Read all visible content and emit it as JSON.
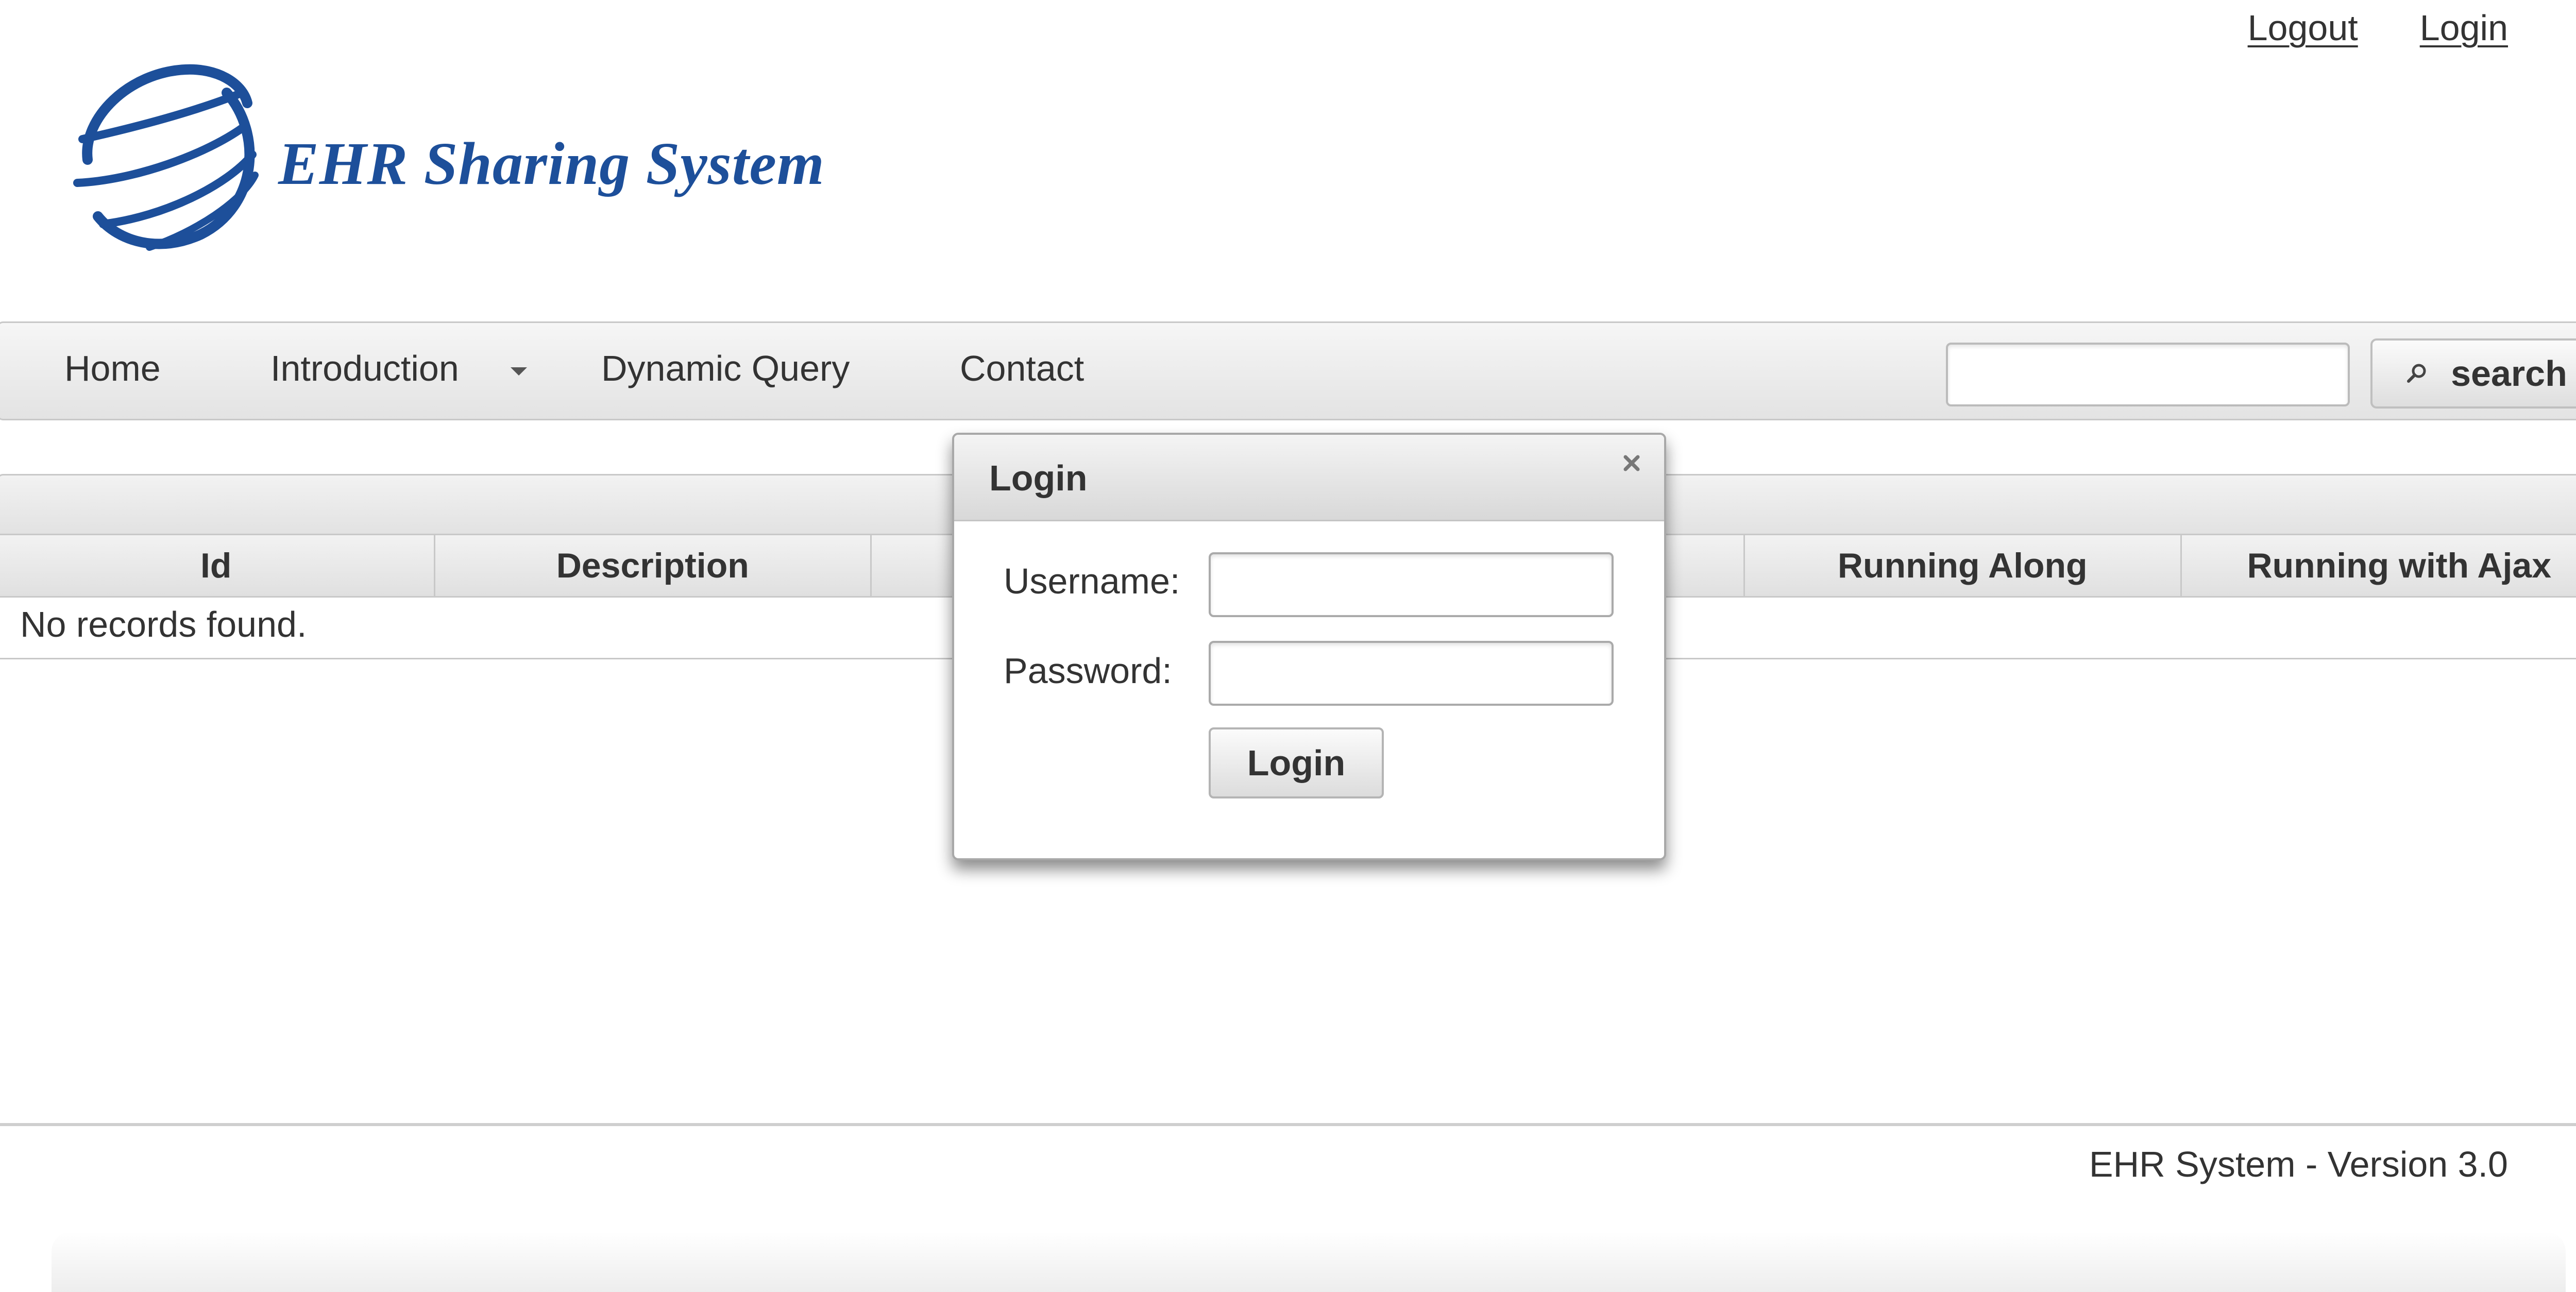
{
  "header": {
    "logout_label": "Logout",
    "login_label": "Login",
    "logo_text": "EHR Sharing System"
  },
  "menu": {
    "items": [
      "Home",
      "Introduction",
      "Dynamic Query",
      "Contact"
    ],
    "search_value": "",
    "search_button_label": "search",
    "search_icon": "search-icon",
    "dropdown_icon": "caret-down-icon"
  },
  "table": {
    "columns": [
      "Id",
      "Description",
      "",
      "",
      "Running Along",
      "Running with Ajax"
    ],
    "empty_message": "No records found."
  },
  "login_dialog": {
    "title": "Login",
    "username_label": "Username:",
    "username_value": "",
    "password_label": "Password:",
    "password_value": "",
    "submit_label": "Login",
    "close_icon": "close-icon"
  },
  "footer": {
    "version_text": "EHR System - Version 3.0"
  },
  "colors": {
    "brand": "#1d4f9a",
    "text": "#333333",
    "border": "#c8c8c8"
  }
}
